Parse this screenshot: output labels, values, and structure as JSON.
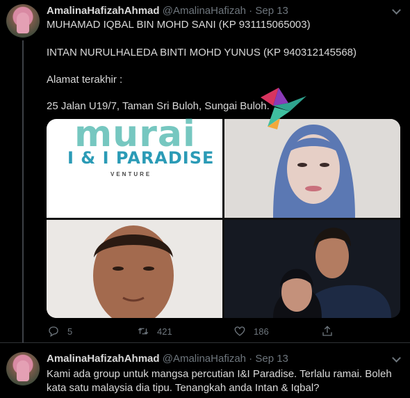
{
  "tweets": [
    {
      "display_name": "AmalinaHafizahAhmad",
      "handle": "@AmalinaHafizah",
      "separator": "·",
      "date": "Sep 13",
      "lines": [
        "MUHAMAD IQBAL BIN MOHD SANI (KP 931115065003)",
        "INTAN NURULHALEDA BINTI MOHD YUNUS (KP 940312145568)",
        "Alamat terakhir :",
        "25 Jalan U19/7, Taman Sri Buloh, Sungai Buloh."
      ],
      "media": {
        "brand_name": "I & I PARADISE",
        "brand_sub": "VENTURE",
        "watermark": "murai"
      },
      "actions": {
        "reply_count": "5",
        "retweet_count": "421",
        "like_count": "186"
      }
    },
    {
      "display_name": "AmalinaHafizahAhmad",
      "handle": "@AmalinaHafizah",
      "separator": "·",
      "date": "Sep 13",
      "text": "Kami ada group untuk mangsa percutian I&I Paradise. Terlalu ramai. Boleh kata satu malaysia dia tipu. Tenangkah anda Intan & Iqbal?"
    }
  ],
  "icons": {
    "reply": "reply-icon",
    "retweet": "retweet-icon",
    "like": "heart-icon",
    "share": "share-icon",
    "more": "chevron-down-icon"
  },
  "colors": {
    "background": "#000000",
    "text": "#d9d9d9",
    "muted": "#6e767d",
    "border": "#2f3336"
  }
}
